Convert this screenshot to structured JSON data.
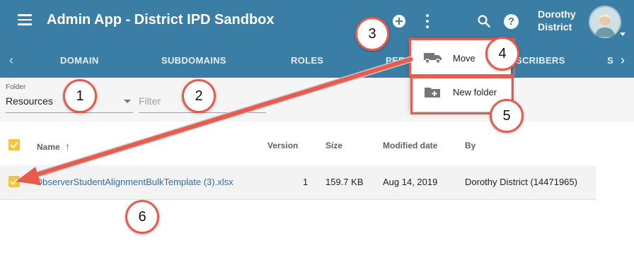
{
  "header": {
    "title": "Admin App - District IPD Sandbox",
    "user_first": "Dorothy",
    "user_last": "District",
    "help_label": "?"
  },
  "tabs": {
    "items": [
      {
        "label": "DOMAIN"
      },
      {
        "label": "SUBDOMAINS"
      },
      {
        "label": "ROLES"
      },
      {
        "label": "PEE"
      },
      {
        "label": "SCRIBERS"
      },
      {
        "label": "S"
      }
    ]
  },
  "folder": {
    "label": "Folder",
    "value": "Resources"
  },
  "filter": {
    "placeholder": "Filter"
  },
  "table": {
    "headers": [
      "Name",
      "Version",
      "Size",
      "Modified date",
      "By"
    ],
    "sort_arrow": "↑",
    "rows": [
      {
        "name": "ObserverStudentAlignmentBulkTemplate (3).xlsx",
        "version": "1",
        "size": "159.7 KB",
        "modified": "Aug 14, 2019",
        "by": "Dorothy District (14471965)"
      }
    ]
  },
  "menu": {
    "move": "Move",
    "new_folder": "New folder"
  },
  "callouts": [
    "1",
    "2",
    "3",
    "4",
    "5",
    "6"
  ],
  "colors": {
    "appbar": "#3a7ea5",
    "checkbox": "#f7c23c",
    "callout": "#e85c4f",
    "link": "#2e6fa6"
  }
}
